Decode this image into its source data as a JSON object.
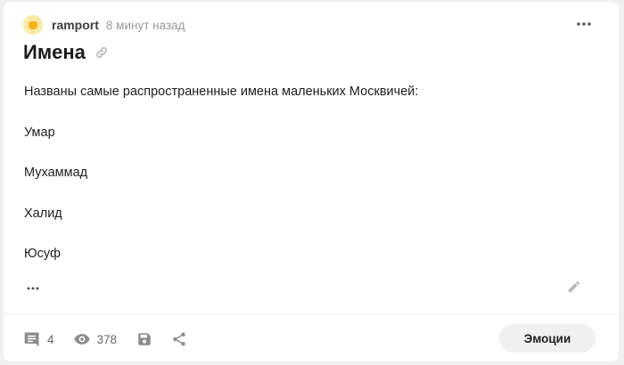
{
  "post": {
    "author": "ramport",
    "time": "8 минут назад",
    "title": "Имена",
    "paragraphs": [
      "Названы самые распространенные имена маленьких Москвичей:",
      "Умар",
      "Мухаммад",
      "Халид",
      "Юсуф"
    ]
  },
  "footer": {
    "comments_count": "4",
    "views_count": "378",
    "emotions_label": "Эмоции"
  },
  "icons": {
    "avatar": "avatar-image",
    "more_top": "more-horizontal-icon",
    "link": "link-icon",
    "more_inline": "more-horizontal-icon",
    "edit": "pencil-icon",
    "comments": "comment-icon",
    "views": "eye-icon",
    "save": "save-icon",
    "share": "share-icon"
  },
  "colors": {
    "background": "#f0f0f0",
    "card": "#ffffff",
    "text": "#1f1f1f",
    "muted": "#9a9a9a",
    "icon": "#8a8a8a",
    "button_bg": "#f0f0f0"
  }
}
